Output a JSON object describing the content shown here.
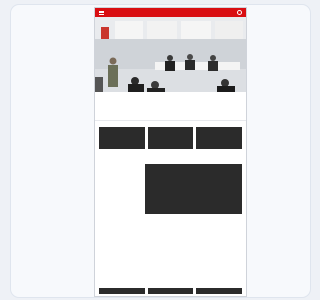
{
  "colors": {
    "brand": "#d90e12",
    "thumb": "#2b2b2b",
    "background": "#eef1f6"
  },
  "topbar": {
    "menu_icon": "hamburger-menu-icon",
    "search_icon": "search-icon"
  },
  "hero": {
    "headline": "",
    "subline": "",
    "cta_label": "",
    "date": ""
  },
  "sections": {
    "first_title": "",
    "second_title": ""
  },
  "cards": [
    {
      "kicker": "",
      "title": "",
      "text": ""
    },
    {
      "kicker": "",
      "title": "",
      "text": ""
    },
    {
      "kicker": "",
      "title": "",
      "text": ""
    }
  ],
  "feature": {
    "kicker": "",
    "title": "",
    "body": ""
  }
}
